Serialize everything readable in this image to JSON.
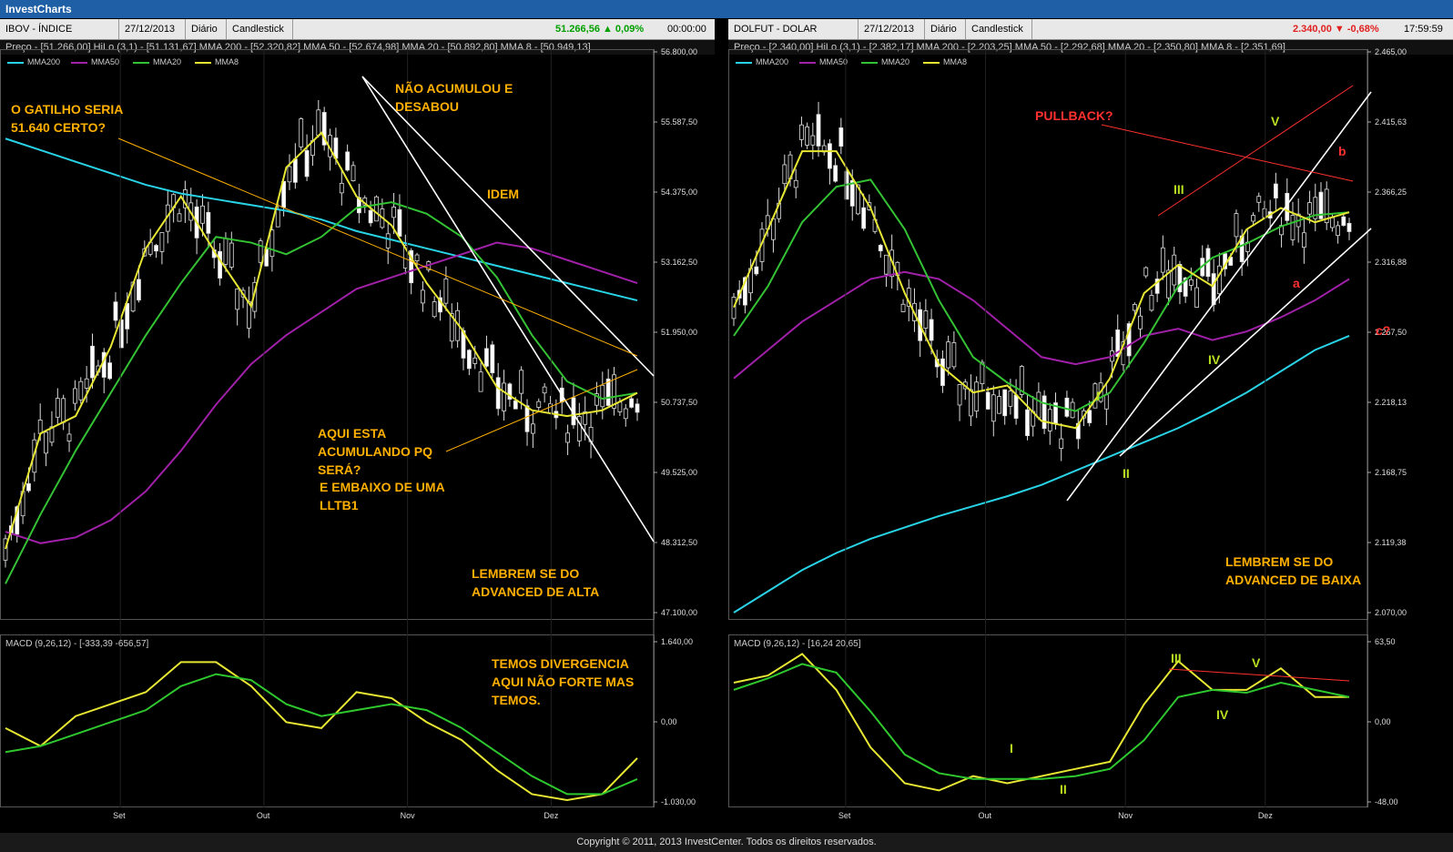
{
  "app_title": "InvestCharts",
  "footer": "Copyright © 2011, 2013 InvestCenter. Todos os direitos reservados.",
  "left": {
    "tabs": [
      "IBOV - ÍNDICE BOVESPA",
      "27/12/2013",
      "Diário",
      "Candlestick"
    ],
    "quote": "51.266,56 ▲ 0,09%",
    "quote_color": "#00c000",
    "time": "00:00:00",
    "info": "Preço - [51.266,00]    HiLo (3,1) - [51.131,67]    MMA 200 - [52.320,82]    MMA 50 - [52.674,98]    MMA 20 - [50.892,80]    MMA 8 - [50.949,13]",
    "legend": [
      {
        "name": "MMA200",
        "color": "#29d3e6"
      },
      {
        "name": "MMA50",
        "color": "#a020a8"
      },
      {
        "name": "MMA20",
        "color": "#33c233"
      },
      {
        "name": "MMA8",
        "color": "#e6e633"
      }
    ],
    "macd_label": "MACD (9,26,12) - [-333,39  -656,57]",
    "x_labels": [
      "Set",
      "Out",
      "Nov",
      "Dez"
    ],
    "annotations": [
      {
        "text": "O GATILHO SERIA\n51.640 CERTO?",
        "color": "#ffb000"
      },
      {
        "text": "NÃO ACUMULOU E\nDESABOU",
        "color": "#ffb000"
      },
      {
        "text": "IDEM",
        "color": "#ffb000"
      },
      {
        "text": "AQUI ESTA\nACUMULANDO PQ\nSERÁ?",
        "color": "#ffb000"
      },
      {
        "text": "E EMBAIXO DE UMA\nLLTB1",
        "color": "#ffb000"
      },
      {
        "text": "LEMBREM SE DO\nADVANCED DE ALTA",
        "color": "#ffb000"
      },
      {
        "text": "TEMOS DIVERGENCIA\nAQUI NÃO FORTE MAS\nTEMOS.",
        "color": "#ffb000"
      }
    ]
  },
  "right": {
    "tabs": [
      "DOLFUT - DOLAR FUTURO",
      "27/12/2013",
      "Diário",
      "Candlestick"
    ],
    "quote": "2.340,00 ▼ -0,68%",
    "quote_color": "#e02020",
    "time": "17:59:59",
    "info": "Preço - [2.340,00]    HiLo (3,1) - [2.382,17]    MMA 200 - [2.203,25]    MMA 50 - [2.292,68]    MMA 20 - [2.350,80]    MMA 8 - [2.351,69]",
    "legend": [
      {
        "name": "MMA200",
        "color": "#29d3e6"
      },
      {
        "name": "MMA50",
        "color": "#a020a8"
      },
      {
        "name": "MMA20",
        "color": "#33c233"
      },
      {
        "name": "MMA8",
        "color": "#e6e633"
      }
    ],
    "macd_label": "MACD (9,26,12) - [16,24  20,65]",
    "x_labels": [
      "Set",
      "Out",
      "Nov",
      "Dez"
    ],
    "annotations": [
      {
        "text": "PULLBACK?",
        "color": "#ff3030"
      },
      {
        "text": "LEMBREM SE DO\nADVANCED DE BAIXA",
        "color": "#ffb000"
      },
      {
        "text": "V",
        "color": "#b8e020"
      },
      {
        "text": "III",
        "color": "#b8e020"
      },
      {
        "text": "IV",
        "color": "#b8e020"
      },
      {
        "text": "I",
        "color": "#b8e020"
      },
      {
        "text": "II",
        "color": "#b8e020"
      },
      {
        "text": "b",
        "color": "#ff3030"
      },
      {
        "text": "a",
        "color": "#ff3030"
      },
      {
        "text": "c?",
        "color": "#ff3030"
      },
      {
        "text": "III",
        "color": "#b8e020"
      },
      {
        "text": "V",
        "color": "#b8e020"
      },
      {
        "text": "IV",
        "color": "#b8e020"
      },
      {
        "text": "I",
        "color": "#b8e020"
      },
      {
        "text": "II",
        "color": "#b8e020"
      }
    ]
  },
  "chart_data": [
    {
      "type": "candlestick",
      "title": "IBOV - ÍNDICE BOVESPA",
      "ylim": [
        47100,
        56800
      ],
      "y_ticks": [
        "56.800,00",
        "55.587,50",
        "54.375,00",
        "53.162,50",
        "51.950,00",
        "50.737,50",
        "49.525,00",
        "48.312,50",
        "47.100,00"
      ],
      "x_labels": [
        "Set",
        "Out",
        "Nov",
        "Dez"
      ],
      "series": [
        {
          "name": "MMA200",
          "values": [
            55300,
            55100,
            54900,
            54700,
            54500,
            54350,
            54250,
            54150,
            54050,
            53900,
            53700,
            53550,
            53400,
            53250,
            53100,
            52950,
            52800,
            52650,
            52500
          ]
        },
        {
          "name": "MMA50",
          "values": [
            48500,
            48300,
            48400,
            48700,
            49200,
            49900,
            50700,
            51400,
            51900,
            52300,
            52700,
            52900,
            53100,
            53300,
            53500,
            53400,
            53200,
            53000,
            52800
          ]
        },
        {
          "name": "MMA20",
          "values": [
            47600,
            48800,
            49900,
            50900,
            51900,
            52800,
            53600,
            53500,
            53300,
            53600,
            54100,
            54200,
            54000,
            53600,
            52900,
            51900,
            51100,
            50800,
            50900
          ]
        },
        {
          "name": "MMA8",
          "values": [
            48200,
            50200,
            50500,
            51700,
            53400,
            54300,
            53300,
            52400,
            54800,
            55400,
            54300,
            53800,
            52800,
            52000,
            51000,
            50600,
            50500,
            50600,
            50900
          ]
        }
      ],
      "macd": {
        "ylim": [
          -1030,
          1640
        ],
        "y_ticks": [
          "1.640,00",
          "0,00",
          "-1.030,00"
        ],
        "series": [
          {
            "name": "MACD",
            "values": [
              200,
              -100,
              400,
              600,
              800,
              1300,
              1300,
              900,
              300,
              200,
              800,
              700,
              300,
              0,
              -500,
              -900,
              -1000,
              -900,
              -300
            ]
          },
          {
            "name": "Sinal",
            "values": [
              -200,
              -100,
              100,
              300,
              500,
              900,
              1100,
              1000,
              600,
              400,
              500,
              600,
              500,
              200,
              -200,
              -600,
              -900,
              -900,
              -650
            ]
          }
        ]
      }
    },
    {
      "type": "candlestick",
      "title": "DOLFUT - DOLAR FUTURO",
      "ylim": [
        2070,
        2465
      ],
      "y_ticks": [
        "2.465,00",
        "2.415,63",
        "2.366,25",
        "2.316,88",
        "2.267,50",
        "2.218,13",
        "2.168,75",
        "2.119,38",
        "2.070,00"
      ],
      "x_labels": [
        "Set",
        "Out",
        "Nov",
        "Dez"
      ],
      "series": [
        {
          "name": "MMA200",
          "values": [
            2070,
            2085,
            2100,
            2112,
            2122,
            2130,
            2138,
            2145,
            2152,
            2160,
            2170,
            2180,
            2190,
            2200,
            2212,
            2225,
            2240,
            2255,
            2265
          ]
        },
        {
          "name": "MMA50",
          "values": [
            2235,
            2255,
            2275,
            2290,
            2305,
            2310,
            2305,
            2290,
            2270,
            2250,
            2245,
            2250,
            2265,
            2270,
            2262,
            2268,
            2278,
            2290,
            2305
          ]
        },
        {
          "name": "MMA20",
          "values": [
            2265,
            2300,
            2345,
            2370,
            2375,
            2340,
            2290,
            2250,
            2232,
            2218,
            2212,
            2225,
            2260,
            2300,
            2320,
            2330,
            2342,
            2350,
            2352
          ]
        },
        {
          "name": "MMA8",
          "values": [
            2285,
            2340,
            2395,
            2395,
            2355,
            2295,
            2245,
            2225,
            2230,
            2205,
            2200,
            2235,
            2295,
            2315,
            2300,
            2340,
            2355,
            2345,
            2352
          ]
        }
      ],
      "macd": {
        "ylim": [
          -48,
          63.5
        ],
        "y_ticks": [
          "63,50",
          "0,00",
          "-48,00"
        ],
        "series": [
          {
            "name": "MACD",
            "values": [
              35,
              40,
              55,
              30,
              -10,
              -35,
              -40,
              -30,
              -35,
              -30,
              -25,
              -20,
              20,
              50,
              30,
              30,
              45,
              25,
              25
            ]
          },
          {
            "name": "Sinal",
            "values": [
              30,
              38,
              48,
              42,
              15,
              -15,
              -28,
              -32,
              -32,
              -32,
              -30,
              -25,
              -5,
              25,
              30,
              28,
              35,
              30,
              25
            ]
          }
        ]
      }
    }
  ]
}
